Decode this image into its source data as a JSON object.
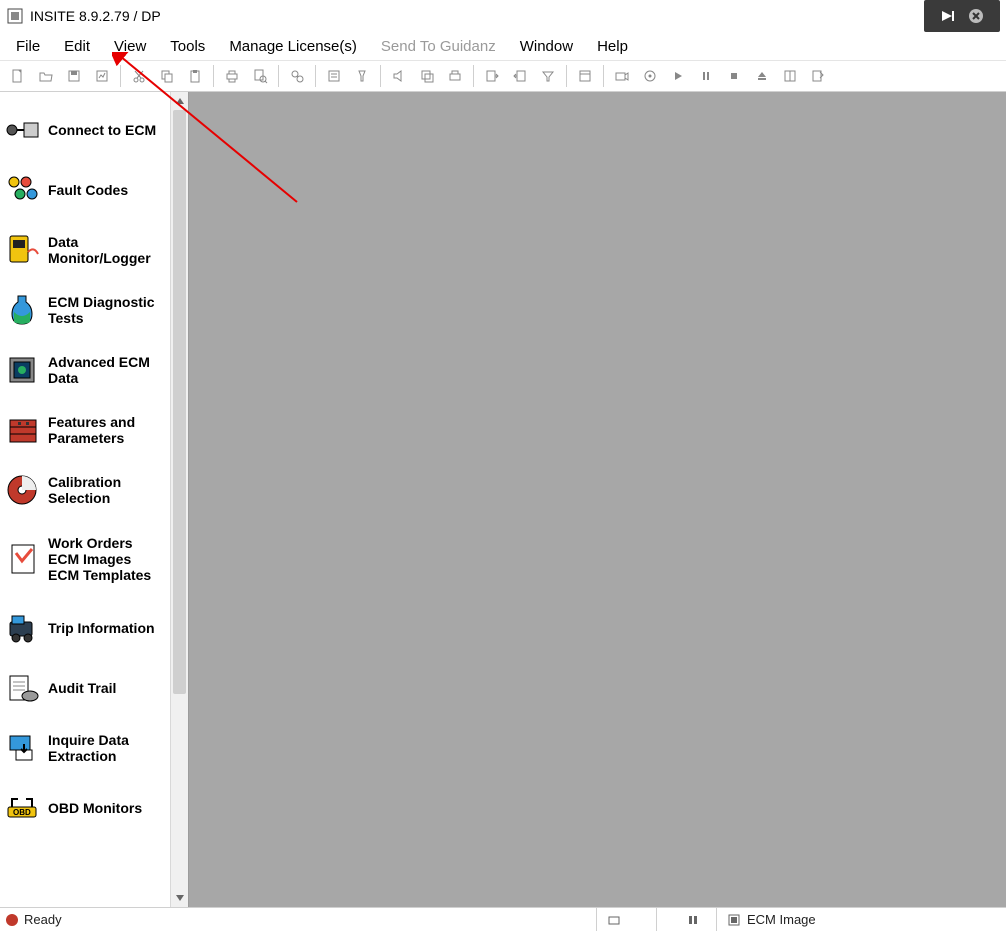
{
  "title": "INSITE 8.9.2.79  / DP",
  "menu": [
    {
      "label": "File",
      "disabled": false
    },
    {
      "label": "Edit",
      "disabled": false
    },
    {
      "label": "View",
      "disabled": false
    },
    {
      "label": "Tools",
      "disabled": false
    },
    {
      "label": "Manage License(s)",
      "disabled": false
    },
    {
      "label": "Send To Guidanz",
      "disabled": true
    },
    {
      "label": "Window",
      "disabled": false
    },
    {
      "label": "Help",
      "disabled": false
    }
  ],
  "toolbar": {
    "buttons": [
      "new-doc-icon",
      "open-doc-icon",
      "save-icon",
      "save-graph-icon",
      "sep",
      "cut-icon",
      "copy-icon",
      "paste-icon",
      "sep",
      "print-icon",
      "print-preview-icon",
      "sep",
      "find-icon",
      "sep",
      "notes-icon",
      "flashlight-icon",
      "sep",
      "speaker-icon",
      "overlay-icon",
      "printer2-icon",
      "sep",
      "export-icon",
      "import-icon",
      "filter-icon",
      "sep",
      "window-icon",
      "sep",
      "camera-icon",
      "disc-icon",
      "play-icon",
      "pause-icon",
      "stop-icon",
      "eject-icon",
      "layout-icon",
      "edit-icon"
    ]
  },
  "sidebar": {
    "items": [
      {
        "label": "Connect to ECM",
        "icon": "connect-ecm-icon"
      },
      {
        "label": "Fault Codes",
        "icon": "fault-codes-icon"
      },
      {
        "label": "Data Monitor/Logger",
        "icon": "data-monitor-icon"
      },
      {
        "label": "ECM Diagnostic Tests",
        "icon": "diagnostic-tests-icon"
      },
      {
        "label": "Advanced ECM Data",
        "icon": "advanced-ecm-icon"
      },
      {
        "label": "Features and Parameters",
        "icon": "features-params-icon"
      },
      {
        "label": "Calibration Selection",
        "icon": "calibration-icon"
      },
      {
        "label": "Work Orders\nECM Images\nECM Templates",
        "icon": "work-orders-icon"
      },
      {
        "label": "Trip Information",
        "icon": "trip-info-icon"
      },
      {
        "label": "Audit Trail",
        "icon": "audit-trail-icon"
      },
      {
        "label": "Inquire Data Extraction",
        "icon": "inquire-data-icon"
      },
      {
        "label": "OBD Monitors",
        "icon": "obd-monitors-icon"
      }
    ]
  },
  "status": {
    "ready": "Ready",
    "right": "ECM Image"
  }
}
